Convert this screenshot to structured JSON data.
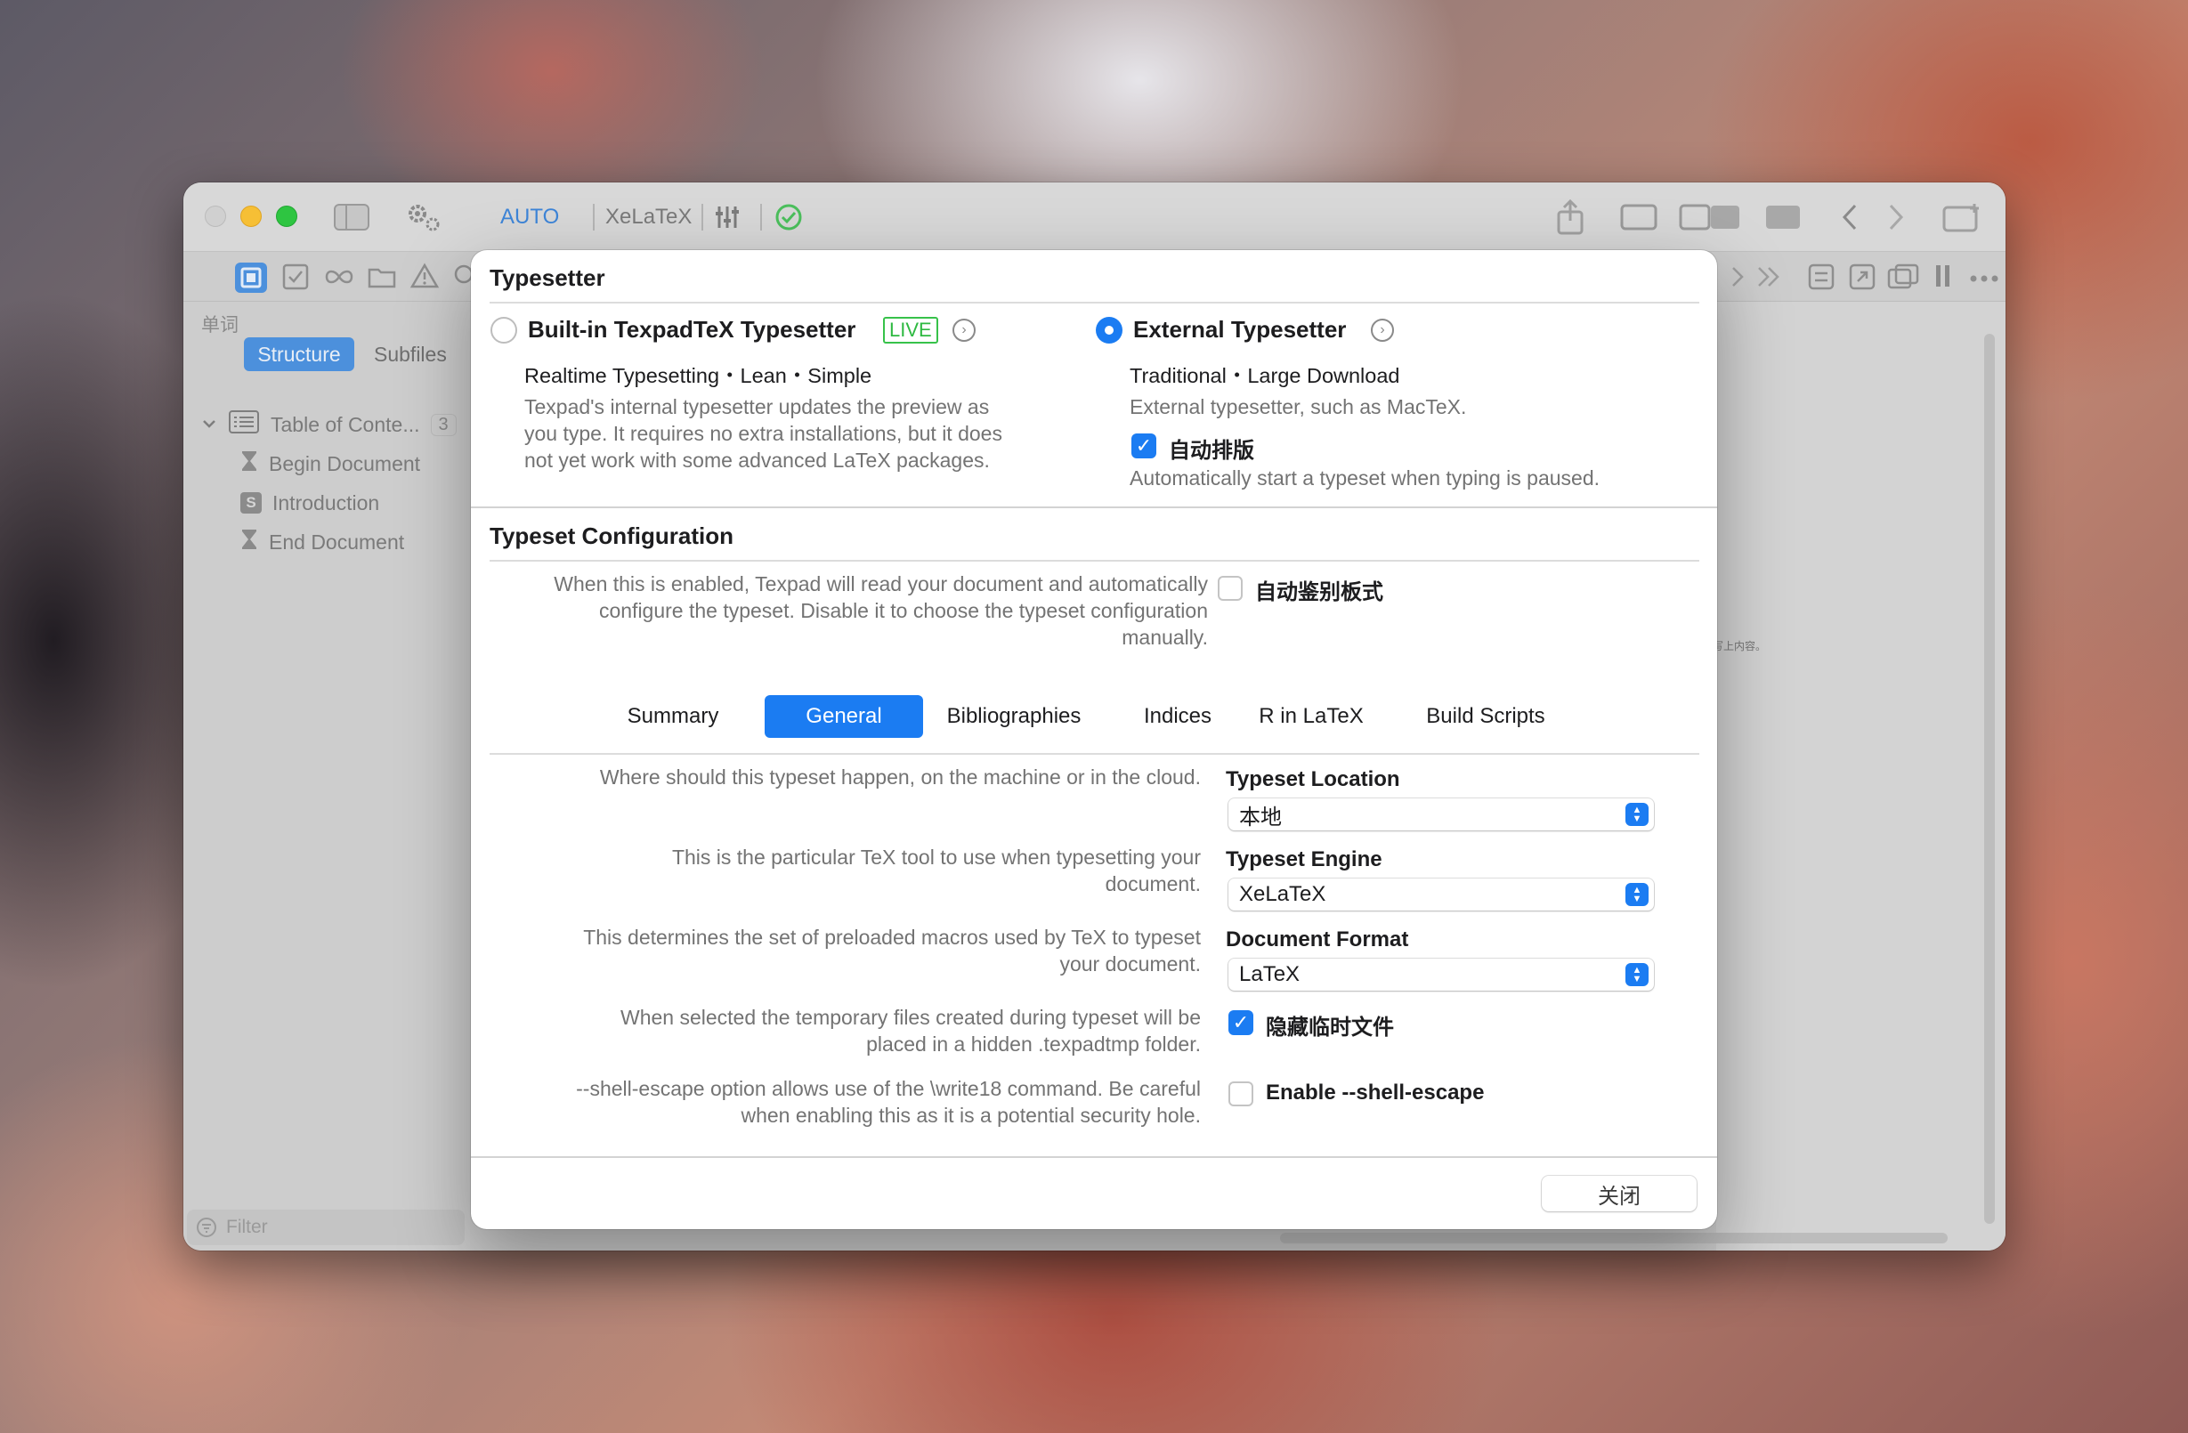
{
  "toolbar": {
    "auto_label": "AUTO",
    "engine_label": "XeLaTeX"
  },
  "sidebar": {
    "search_label": "单词",
    "tabs": {
      "structure": "Structure",
      "subfiles": "Subfiles"
    },
    "tree": {
      "root": "Table of Conte...",
      "root_count": "3",
      "items": [
        {
          "label": "Begin Document",
          "icon": "hourglass-icon"
        },
        {
          "label": "Introduction",
          "icon": "section-s-icon",
          "badge": "S"
        },
        {
          "label": "End Document",
          "icon": "hourglass-icon"
        }
      ]
    },
    "filter_placeholder": "Filter"
  },
  "editor": {
    "tiny_note": "写上内容。"
  },
  "dialog": {
    "typesetter": {
      "title": "Typesetter",
      "builtin": {
        "title": "Built-in TexpadTeX Typesetter",
        "badge": "LIVE",
        "tagline": "Realtime Typesetting・Lean・Simple",
        "desc_lines": [
          "Texpad's internal typesetter updates the preview as",
          "you type. It requires no extra installations, but it does",
          "not yet work with some advanced LaTeX packages."
        ],
        "selected": false
      },
      "external": {
        "title": "External Typesetter",
        "tagline": "Traditional・Large Download",
        "desc": "External typesetter, such as MacTeX.",
        "auto_typeset_label": "自动排版",
        "auto_typeset_checked": true,
        "auto_typeset_desc": "Automatically start a typeset when typing is paused.",
        "selected": true
      }
    },
    "config": {
      "title": "Typeset Configuration",
      "auto_desc_lines": [
        "When this is enabled, Texpad will read your document and automatically",
        "configure the typeset. Disable it to choose the typeset configuration",
        "manually."
      ],
      "auto_detect_label": "自动鉴别板式",
      "auto_detect_checked": false,
      "tabs": [
        "Summary",
        "General",
        "Bibliographies",
        "Indices",
        "R in LaTeX",
        "Build Scripts"
      ],
      "active_tab": "General",
      "location": {
        "desc_lines": [
          "Where should this typeset happen, on the machine or in the cloud."
        ],
        "label": "Typeset Location",
        "value": "本地"
      },
      "engine": {
        "desc_lines": [
          "This is the particular TeX tool to use when typesetting your",
          "document."
        ],
        "label": "Typeset Engine",
        "value": "XeLaTeX"
      },
      "format": {
        "desc_lines": [
          "This determines the set of preloaded macros used by TeX to typeset",
          "your document."
        ],
        "label": "Document Format",
        "value": "LaTeX"
      },
      "hide_temp": {
        "desc_lines": [
          "When selected the temporary files created during typeset will be",
          "placed in a hidden .texpadtmp folder."
        ],
        "label": "隐藏临时文件",
        "checked": true
      },
      "shell_escape": {
        "desc_lines": [
          "--shell-escape option allows use of the \\write18 command. Be careful",
          "when enabling this as it is a potential security hole."
        ],
        "label": "Enable --shell-escape",
        "checked": false
      }
    },
    "close_label": "关闭"
  },
  "colors": {
    "accent": "#1b7cf2",
    "live_green": "#2eb941",
    "traffic_yellow": "#f6bf35",
    "traffic_green": "#2ec541"
  }
}
